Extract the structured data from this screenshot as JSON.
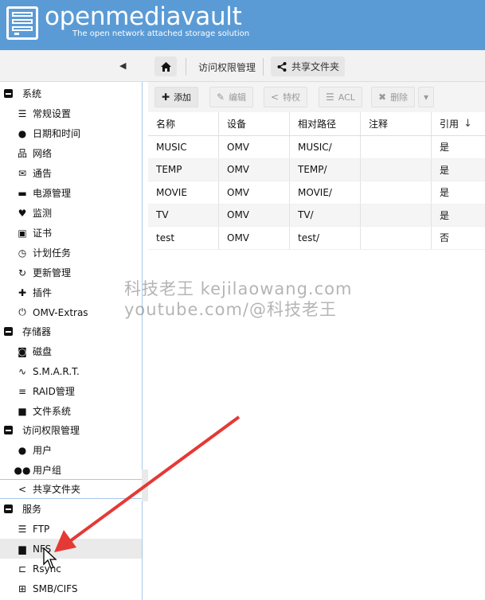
{
  "header": {
    "brand": "openmediavault",
    "tagline": "The open network attached storage solution"
  },
  "breadcrumb": {
    "items": [
      "访问权限管理",
      "共享文件夹"
    ]
  },
  "sidebar": {
    "groups": [
      {
        "label": "系统",
        "items": [
          {
            "label": "常规设置",
            "icon": "sliders-icon"
          },
          {
            "label": "日期和时间",
            "icon": "clock-icon"
          },
          {
            "label": "网络",
            "icon": "network-icon"
          },
          {
            "label": "通告",
            "icon": "envelope-icon"
          },
          {
            "label": "电源管理",
            "icon": "battery-icon"
          },
          {
            "label": "监测",
            "icon": "heartbeat-icon"
          },
          {
            "label": "证书",
            "icon": "certificate-icon"
          },
          {
            "label": "计划任务",
            "icon": "calendar-clock-icon"
          },
          {
            "label": "更新管理",
            "icon": "refresh-icon"
          },
          {
            "label": "插件",
            "icon": "puzzle-icon"
          },
          {
            "label": "OMV-Extras",
            "icon": "plug-icon"
          }
        ]
      },
      {
        "label": "存储器",
        "items": [
          {
            "label": "磁盘",
            "icon": "hdd-icon"
          },
          {
            "label": "S.M.A.R.T.",
            "icon": "pulse-icon"
          },
          {
            "label": "RAID管理",
            "icon": "database-icon"
          },
          {
            "label": "文件系统",
            "icon": "folder-icon"
          }
        ]
      },
      {
        "label": "访问权限管理",
        "items": [
          {
            "label": "用户",
            "icon": "user-icon"
          },
          {
            "label": "用户组",
            "icon": "users-icon"
          },
          {
            "label": "共享文件夹",
            "icon": "share-icon"
          }
        ]
      },
      {
        "label": "服务",
        "items": [
          {
            "label": "FTP",
            "icon": "server-icon"
          },
          {
            "label": "NFS",
            "icon": "desktop-icon"
          },
          {
            "label": "Rsync",
            "icon": "sitemap-icon"
          },
          {
            "label": "SMB/CIFS",
            "icon": "windows-icon"
          }
        ]
      }
    ]
  },
  "toolbar": {
    "add": "添加",
    "edit": "编辑",
    "privileges": "特权",
    "acl": "ACL",
    "delete": "删除"
  },
  "table": {
    "columns": [
      "名称",
      "设备",
      "相对路径",
      "注释",
      "引用"
    ],
    "rows": [
      [
        "MUSIC",
        "OMV",
        "MUSIC/",
        "",
        "是"
      ],
      [
        "TEMP",
        "OMV",
        "TEMP/",
        "",
        "是"
      ],
      [
        "MOVIE",
        "OMV",
        "MOVIE/",
        "",
        "是"
      ],
      [
        "TV",
        "OMV",
        "TV/",
        "",
        "是"
      ],
      [
        "test",
        "OMV",
        "test/",
        "",
        "否"
      ]
    ]
  },
  "watermark": {
    "line1": "科技老王 kejilaowang.com",
    "line2": "youtube.com/@科技老王"
  },
  "colors": {
    "header": "#5b9bd5",
    "arrow": "#e53935",
    "selection_border": "#a8c8ea"
  }
}
